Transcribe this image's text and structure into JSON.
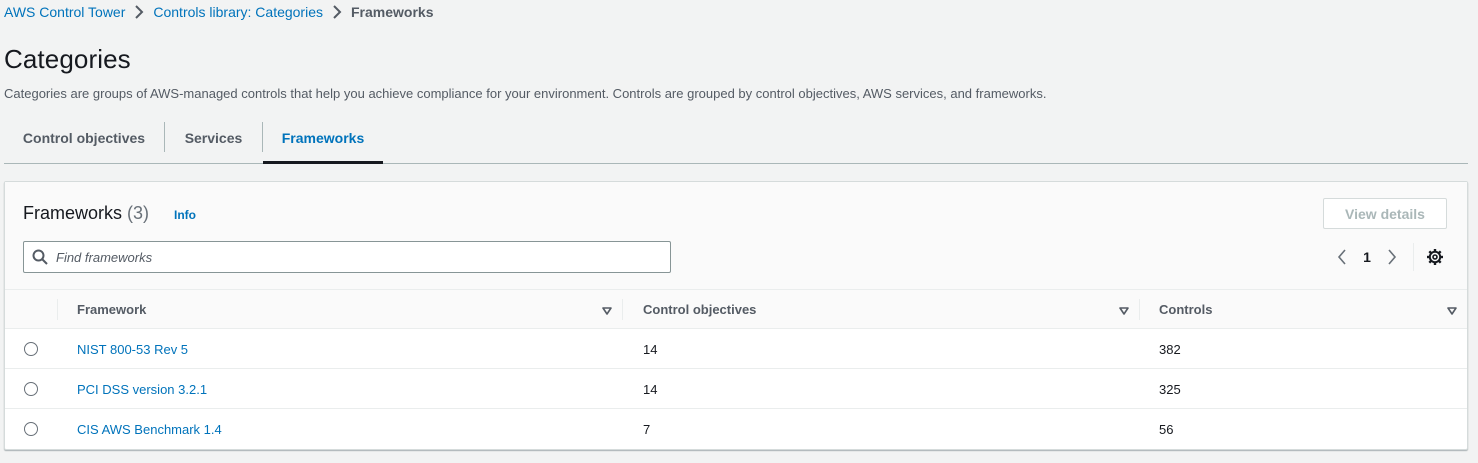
{
  "breadcrumb": {
    "items": [
      "AWS Control Tower",
      "Controls library: Categories"
    ],
    "current": "Frameworks"
  },
  "header": {
    "title": "Categories",
    "description": "Categories are groups of AWS-managed controls that help you achieve compliance for your environment. Controls are grouped by control objectives, AWS services, and frameworks."
  },
  "tabs": [
    {
      "label": "Control objectives",
      "active": false
    },
    {
      "label": "Services",
      "active": false
    },
    {
      "label": "Frameworks",
      "active": true
    }
  ],
  "panel": {
    "title": "Frameworks",
    "count": "(3)",
    "info": "Info",
    "view_details": "View details",
    "search_placeholder": "Find frameworks",
    "page": "1"
  },
  "table": {
    "columns": [
      "Framework",
      "Control objectives",
      "Controls"
    ],
    "rows": [
      {
        "framework": "NIST 800-53 Rev 5",
        "objectives": "14",
        "controls": "382"
      },
      {
        "framework": "PCI DSS version 3.2.1",
        "objectives": "14",
        "controls": "325"
      },
      {
        "framework": "CIS AWS Benchmark 1.4",
        "objectives": "7",
        "controls": "56"
      }
    ]
  },
  "icons": {
    "breadcrumb_sep": "chevron-right-icon",
    "search": "search-icon",
    "prev": "chevron-left-icon",
    "next": "chevron-right-icon",
    "settings": "gear-icon",
    "sort": "sort-caret-icon"
  },
  "colors": {
    "link": "#0073bb",
    "background": "#f2f3f3",
    "text": "#16191f",
    "muted": "#545b64"
  }
}
